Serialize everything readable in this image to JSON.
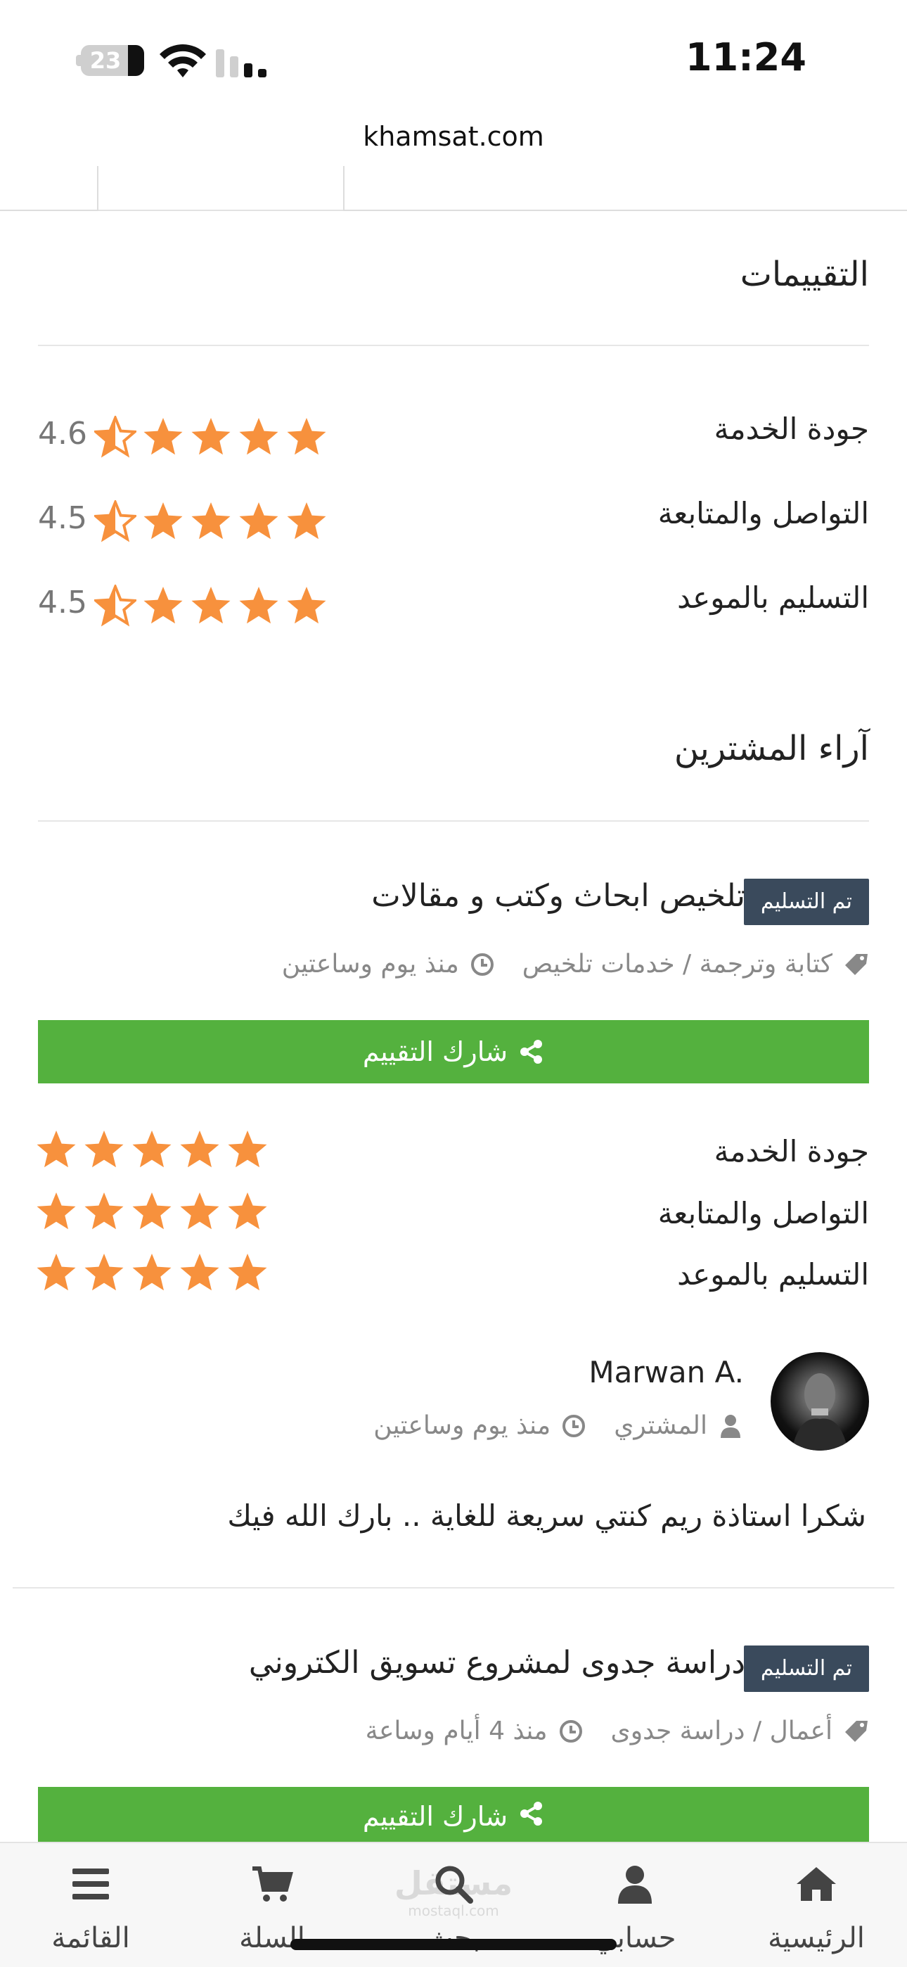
{
  "status_bar": {
    "time": "11:24",
    "battery": "23"
  },
  "browser": {
    "url": "khamsat.com"
  },
  "ratings": {
    "title": "التقييمات",
    "rows": [
      {
        "label": "جودة الخدمة",
        "score": "4.6",
        "value": 4.6
      },
      {
        "label": "التواصل والمتابعة",
        "score": "4.5",
        "value": 4.5
      },
      {
        "label": "التسليم بالموعد",
        "score": "4.5",
        "value": 4.5
      }
    ]
  },
  "reviews_section": {
    "title": "آراء المشترين",
    "items": [
      {
        "badge": "تم التسليم",
        "title": "تلخيص ابحاث وكتب و مقالات",
        "category": "كتابة وترجمة / خدمات تلخيص",
        "time": "منذ يوم وساعتين",
        "share_label": "شارك التقييم",
        "criteria": [
          {
            "label": "جودة الخدمة",
            "value": 5
          },
          {
            "label": "التواصل والمتابعة",
            "value": 5
          },
          {
            "label": "التسليم بالموعد",
            "value": 5
          }
        ],
        "reviewer": {
          "name": "Marwan A.",
          "role": "المشتري",
          "time": "منذ يوم وساعتين"
        },
        "comment": "شكرا استاذة ريم كنتي سريعة للغاية .. بارك الله فيك"
      },
      {
        "badge": "تم التسليم",
        "title": "دراسة جدوى لمشروع تسويق الكتروني",
        "category": "أعمال / دراسة جدوى",
        "time": "منذ 4 أيام وساعة",
        "share_label": "شارك التقييم"
      }
    ]
  },
  "bottom_nav": {
    "items": [
      {
        "label": "الرئيسية",
        "icon": "home-icon"
      },
      {
        "label": "حسابي",
        "icon": "user-icon"
      },
      {
        "label": "بحث",
        "icon": "search-icon"
      },
      {
        "label": "السلة",
        "icon": "cart-icon"
      },
      {
        "label": "القائمة",
        "icon": "menu-icon"
      }
    ]
  },
  "watermark": {
    "text": "مستقل",
    "sub": "mostaql.com"
  },
  "colors": {
    "star": "#f7913d",
    "share_button": "#54b13e",
    "badge": "#3a4a5c"
  }
}
